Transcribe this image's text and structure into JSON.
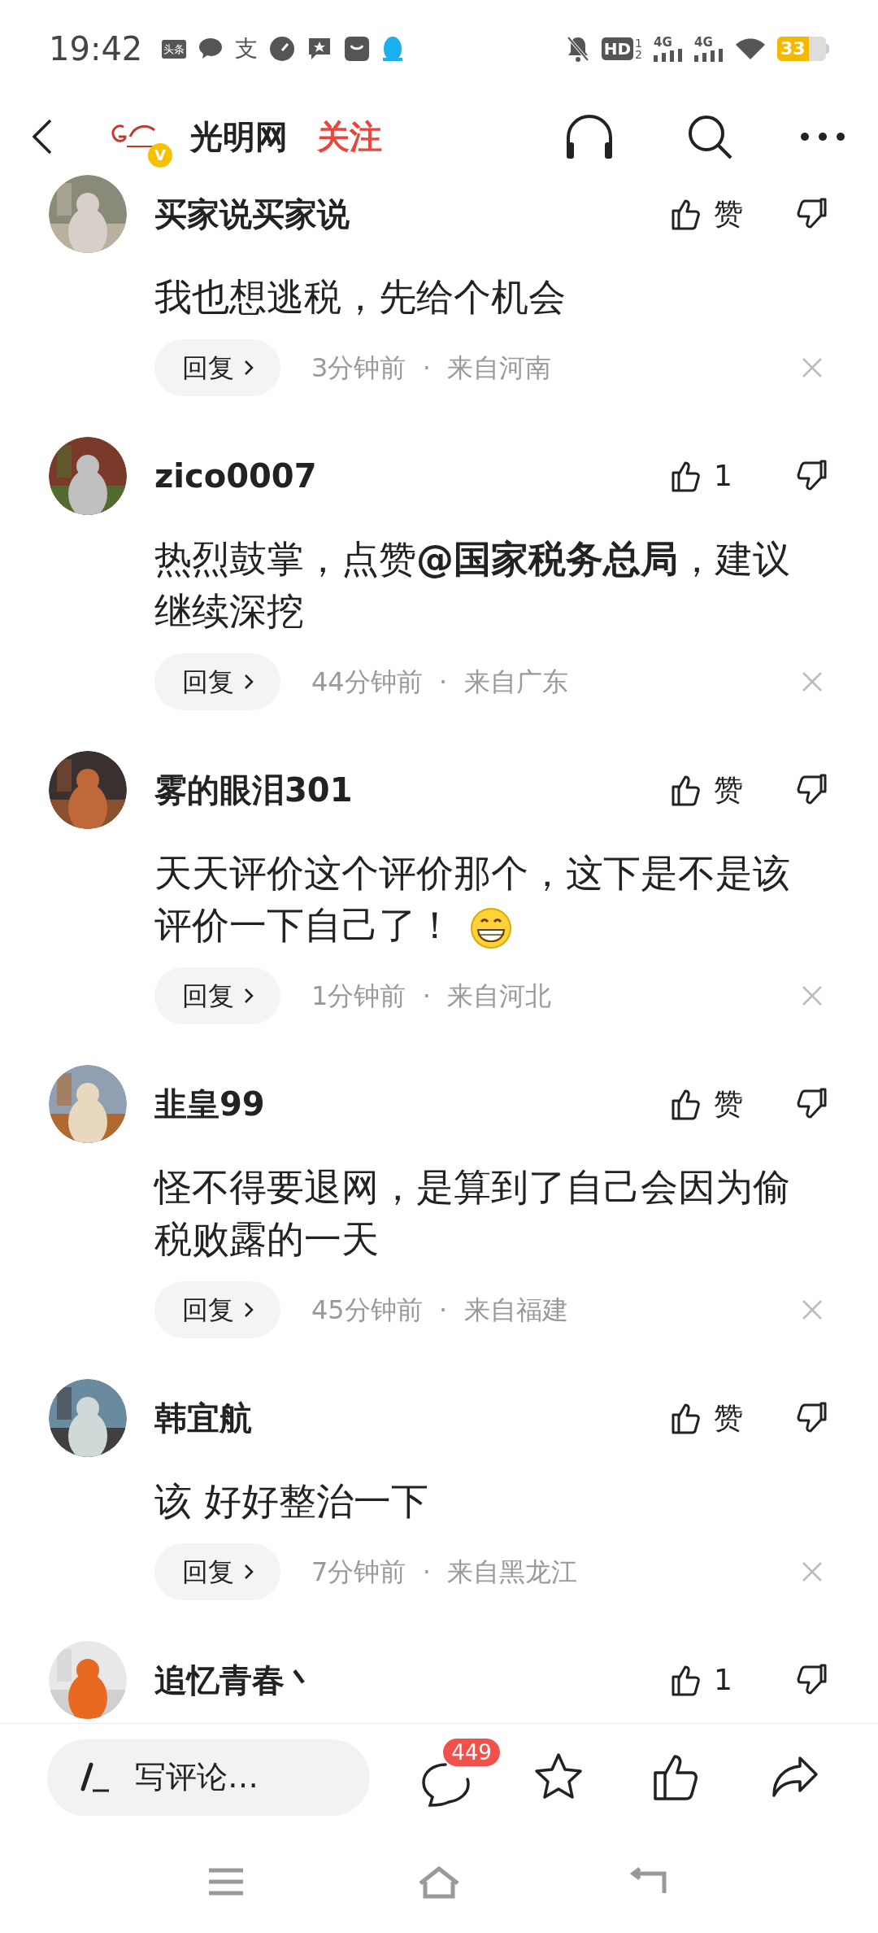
{
  "status_bar": {
    "time": "19:42",
    "app_badge": "头条",
    "pay_glyph": "支",
    "network": "HD",
    "network_sub": [
      "1",
      "2"
    ],
    "signals": [
      "4G",
      "4G"
    ],
    "battery": "33"
  },
  "header": {
    "account": "光明网",
    "verified_mark": "V",
    "follow": "关注"
  },
  "comments": [
    {
      "name": "买家说买家说",
      "text": "我也想逃税，先给个机会",
      "like": "赞",
      "reply": "回复",
      "meta": "3分钟前  ·  来自河南"
    },
    {
      "name": "zico0007",
      "text": "热烈鼓掌，点赞**@国家税务总局**，建议继续深挖",
      "like": "1",
      "reply": "回复",
      "meta": "44分钟前  ·  来自广东"
    },
    {
      "name": "雾的眼泪301",
      "text": "天天评价这个评价那个，这下是不是该评价一下自己了！",
      "emoji": true,
      "like": "赞",
      "reply": "回复",
      "meta": "1分钟前  ·  来自河北"
    },
    {
      "name": "韭皇99",
      "text": "怪不得要退网，是算到了自己会因为偷税败露的一天",
      "like": "赞",
      "reply": "回复",
      "meta": "45分钟前  ·  来自福建"
    },
    {
      "name": "韩宜航",
      "text": "该 好好整治一下",
      "like": "赞",
      "reply": "回复",
      "meta": "7分钟前  ·  来自黑龙江"
    },
    {
      "name": "追忆青春丶",
      "like": "1"
    }
  ],
  "bottom_bar": {
    "placeholder": "写评论…",
    "comment_count": "449"
  }
}
